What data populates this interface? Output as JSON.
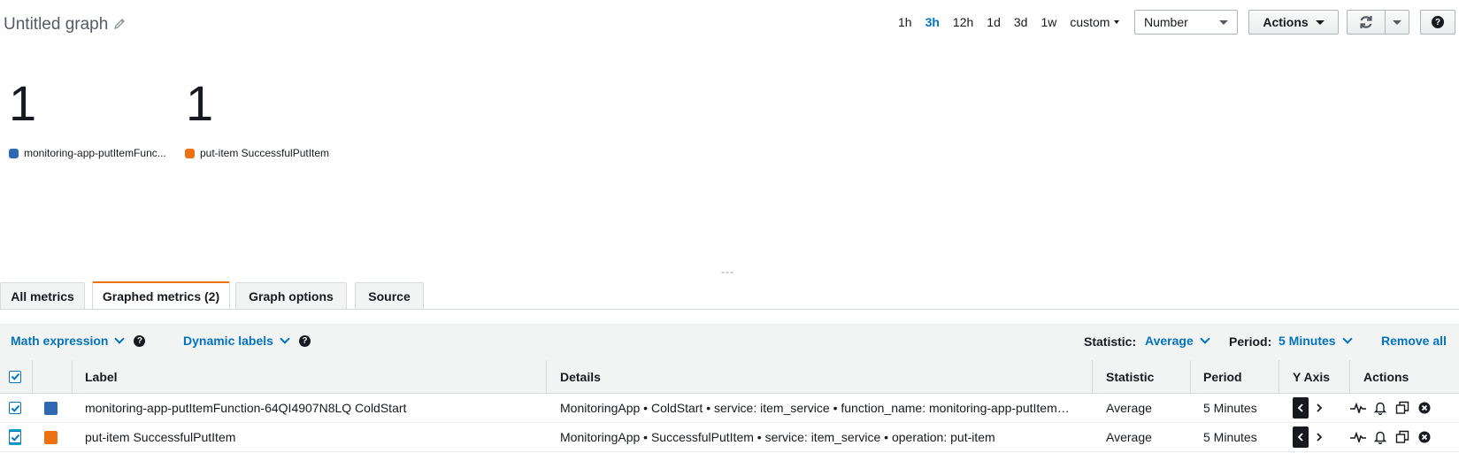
{
  "header": {
    "title": "Untitled graph",
    "time_ranges": [
      "1h",
      "3h",
      "12h",
      "1d",
      "3d",
      "1w"
    ],
    "active_range": "3h",
    "custom_label": "custom",
    "view_select": "Number",
    "actions_label": "Actions",
    "help_icon": "question-circle-icon"
  },
  "number_widgets": [
    {
      "value": "1",
      "label": "monitoring-app-putItemFunc...",
      "color": "#2f67b1"
    },
    {
      "value": "1",
      "label": "put-item SuccessfulPutItem",
      "color": "#ec7211"
    }
  ],
  "resize_handle": "---",
  "tabs": [
    {
      "label": "All metrics",
      "active": false
    },
    {
      "label": "Graphed metrics (2)",
      "active": true
    },
    {
      "label": "Graph options",
      "active": false
    },
    {
      "label": "Source",
      "active": false
    }
  ],
  "toolbar": {
    "math_expression": "Math expression",
    "dynamic_labels": "Dynamic labels",
    "statistic_label": "Statistic:",
    "statistic_value": "Average",
    "period_label": "Period:",
    "period_value": "5 Minutes",
    "remove_all": "Remove all"
  },
  "table": {
    "columns": [
      "Label",
      "Details",
      "Statistic",
      "Period",
      "Y Axis",
      "Actions"
    ],
    "rows": [
      {
        "checked": true,
        "color": "#2f67b1",
        "label": "monitoring-app-putItemFunction-64QI4907N8LQ ColdStart",
        "details": "MonitoringApp • ColdStart • service: item_service • function_name: monitoring-app-putItem…",
        "statistic": "Average",
        "period": "5 Minutes"
      },
      {
        "checked": true,
        "color": "#ec7211",
        "label": "put-item SuccessfulPutItem",
        "details": "MonitoringApp • SuccessfulPutItem • service: item_service • operation: put-item",
        "statistic": "Average",
        "period": "5 Minutes"
      }
    ]
  }
}
